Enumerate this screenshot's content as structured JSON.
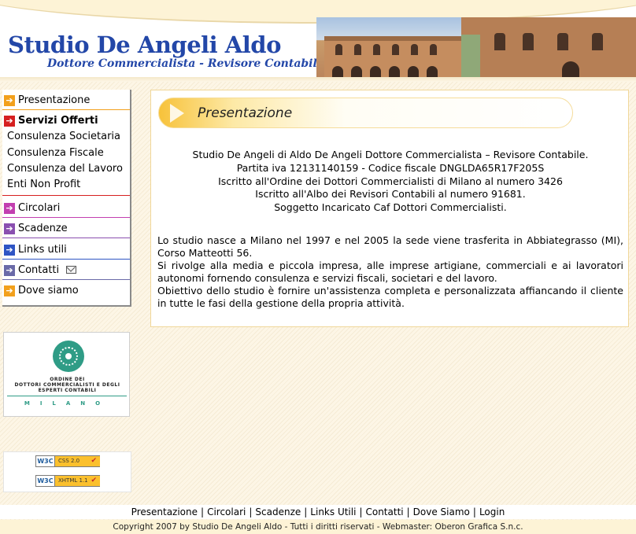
{
  "header": {
    "title": "Studio De Angeli Aldo",
    "subtitle": "Dottore Commercialista - Revisore Contabile"
  },
  "menu": {
    "presentazione": "Presentazione",
    "servizi": "Servizi Offerti",
    "sub_items": [
      "Consulenza Societaria",
      "Consulenza Fiscale",
      "Consulenza del Lavoro",
      "Enti Non Profit"
    ],
    "circolari": "Circolari",
    "scadenze": "Scadenze",
    "links": "Links utili",
    "contatti": "Contatti",
    "dove": "Dove siamo"
  },
  "ordine": {
    "line1": "ORDINE DEI",
    "line2": "DOTTORI COMMERCIALISTI E DEGLI",
    "line3": "ESPERTI CONTABILI",
    "city": "MILANO"
  },
  "badges": {
    "w3c": "W3C",
    "css": "CSS 2.0",
    "xhtml": "XHTML 1.1",
    "check": "✔"
  },
  "content": {
    "title": "Presentazione",
    "info_lines": [
      "Studio De Angeli di Aldo De Angeli Dottore Commercialista – Revisore Contabile.",
      "Partita iva 12131140159 - Codice fiscale DNGLDA65R17F205S",
      "Iscritto all'Ordine dei Dottori Commercialisti di Milano al numero 3426",
      "Iscritto all'Albo dei Revisori Contabili al numero 91681.",
      "Soggetto Incaricato Caf Dottori Commercialisti."
    ],
    "paragraphs": [
      "Lo studio nasce a Milano nel 1997 e nel 2005 la sede viene trasferita in Abbiategrasso (MI), Corso Matteotti 56.",
      "Si rivolge alla media e piccola impresa, alle imprese artigiane, commerciali e ai lavoratori autonomi fornendo consulenza e servizi fiscali, societari e del lavoro.",
      "Obiettivo dello studio è fornire un'assistenza completa e personalizzata affiancando il cliente in tutte le fasi della gestione della propria attività."
    ]
  },
  "footer": {
    "links": [
      "Presentazione",
      "Circolari",
      "Scadenze",
      "Links Utili",
      "Contatti",
      "Dove Siamo",
      "Login"
    ],
    "separator": "|",
    "copyright": "Copyright 2007 by Studio De Angeli Aldo - Tutti i diritti riservati - Webmaster: Oberon Grafica S.n.c."
  },
  "colors": {
    "brand_blue": "#2347a8",
    "accent_yellow": "#f7c23a",
    "arrow_orange": "#f2a01c",
    "arrow_red": "#d62020",
    "arrow_magenta": "#c23fb0",
    "arrow_purple": "#8a4fb0",
    "arrow_blue": "#2f55c4",
    "ordine_green": "#2f9c86"
  }
}
